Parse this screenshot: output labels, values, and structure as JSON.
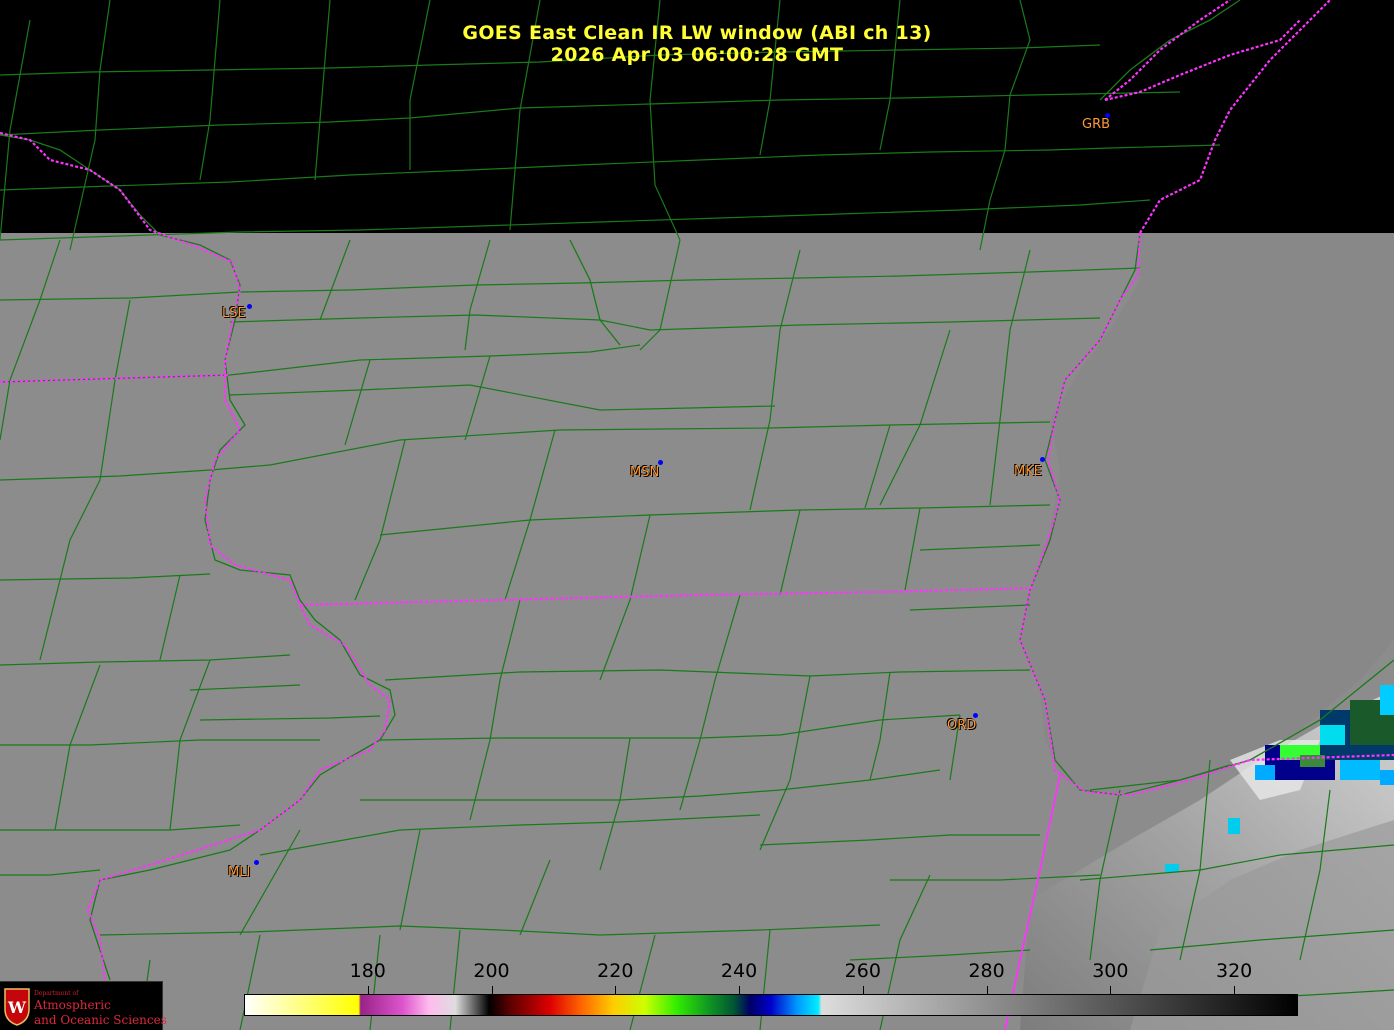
{
  "header": {
    "line1": "GOES East Clean IR LW window (ABI ch 13)",
    "line2": "2026 Apr 03  06:00:28 GMT"
  },
  "stations": [
    {
      "id": "GRB",
      "label": "GRB"
    },
    {
      "id": "LSE",
      "label": "LSE"
    },
    {
      "id": "MSN",
      "label": "MSN"
    },
    {
      "id": "MKE",
      "label": "MKE"
    },
    {
      "id": "ORD",
      "label": "ORD"
    },
    {
      "id": "MLI",
      "label": "MLI"
    }
  ],
  "colorbar": {
    "units_range": [
      160,
      330
    ],
    "ticks": [
      "180",
      "200",
      "220",
      "240",
      "260",
      "280",
      "300",
      "320"
    ],
    "tick_values": [
      180,
      200,
      220,
      240,
      260,
      280,
      300,
      320
    ]
  },
  "logo": {
    "line1": "Department of",
    "line2": "Atmospheric",
    "line3": "and Oceanic Sciences",
    "shield_letter": "W"
  },
  "colors": {
    "title": "#ffff33",
    "county_lines": "#1a7a1a",
    "state_lines": "#ff33ff",
    "station_label": "#ff9933",
    "station_dot": "#0000ff",
    "land_gray": "#8c8c8c",
    "lake_gray": "#868686",
    "no_data": "#000000",
    "logo_red": "#c5050c"
  }
}
